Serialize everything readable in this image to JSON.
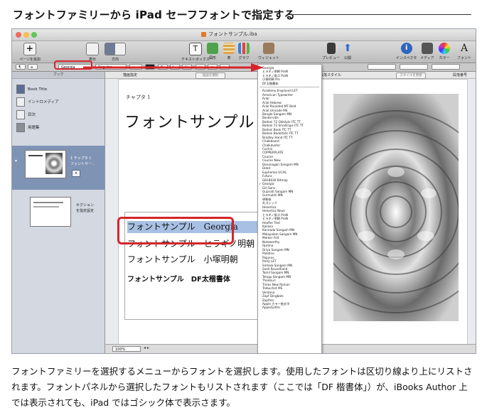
{
  "article": {
    "title": "フォントファミリーから iPad セーフフォントで指定する",
    "caption": "フォントファミリーを選択するメニューからフォントを選択します。使用したフォントは区切り線より上にリストされます。フォントパネルから選択したフォントもリストされます（ここでは「DF 楷書体」）が、iBooks Author 上では表示されても、iPad ではゴシック体で表示さます。"
  },
  "window": {
    "title": "フォントサンプル.iba"
  },
  "toolbar": {
    "buttons": [
      {
        "label": "ページを追加",
        "icon": "add-page-icon"
      },
      {
        "label": "表示",
        "icon": "view-icon"
      },
      {
        "label": "方向",
        "icon": "orientation-icon"
      },
      {
        "label": "テキストボックス",
        "icon": "textbox-icon"
      },
      {
        "label": "図形",
        "icon": "shape-icon"
      },
      {
        "label": "表",
        "icon": "table-icon"
      },
      {
        "label": "グラフ",
        "icon": "chart-icon"
      },
      {
        "label": "ウィジェット",
        "icon": "widget-icon"
      },
      {
        "label": "プレビュー",
        "icon": "preview-icon"
      },
      {
        "label": "公開",
        "icon": "publish-icon"
      },
      {
        "label": "インスペクタ",
        "icon": "inspector-icon"
      },
      {
        "label": "メディア",
        "icon": "media-icon"
      },
      {
        "label": "カラー",
        "icon": "color-icon"
      },
      {
        "label": "フォント",
        "icon": "font-icon"
      }
    ]
  },
  "formatbar": {
    "font_family": "Georgia",
    "font_style": "Regular"
  },
  "rulerbar": {
    "left_label": "描画指定",
    "left_button": "描画を選択",
    "style_label": "段落スタイル",
    "style_button": "スタイルを更新",
    "right_label": "段落番号"
  },
  "sidebar": {
    "header": "ブック",
    "items": [
      {
        "label": "Book Title",
        "icon": "book-icon"
      },
      {
        "label": "イントロメディア",
        "icon": "intro-media-icon"
      },
      {
        "label": "目次",
        "icon": "toc-icon"
      },
      {
        "label": "用語集",
        "icon": "glossary-icon"
      }
    ],
    "thumbnails": [
      {
        "label_line1": "1 チャプタ 1",
        "label_line2": "フォントサー…"
      },
      {
        "label_line1": "セクション",
        "label_line2": "を指定設定"
      }
    ]
  },
  "document": {
    "chapter_label": "チャプタ 1",
    "chapter_title": "フォントサンプル",
    "sample_lines": [
      "フォントサンプル　Georgia",
      "フォントサンプル　ヒラギノ明朝",
      "フォントサンプル　小塚明朝",
      "フォントサンプル　DF太楷書体"
    ]
  },
  "status": {
    "zoom": "100%"
  },
  "font_menu": {
    "recent": [
      "Georgia",
      "ヒラギノ明朝 ProN",
      "ヒラギノ角ゴ ProN",
      "小塚明朝 Pro",
      "DF太楷書体"
    ],
    "checked_recent": "Georgia",
    "all": [
      "Academy Engraved LET",
      "American Typewriter",
      "Arial",
      "Arial Hebrew",
      "Arial Rounded MT Bold",
      "Arial Unicode MS",
      "Bangla Sangam MN",
      "Baskerville",
      "Bodoni 72 Oldstyle ITC TT",
      "Bodoni 72 Smallcaps ITC TT",
      "Bodoni Book ITC TT",
      "Bodoni BookItalic ITC TT",
      "Bradley Hand ITC TT",
      "Chalkboard",
      "Chalkduster",
      "Cochin",
      "COPPERPLATE",
      "Courier",
      "Courier New",
      "Devanagari Sangam MN",
      "Didot",
      "Euphemia UCAS",
      "Futura",
      "GB18030 Bitmap",
      "Georgia",
      "Gill Sans",
      "Gujarati Sangam MN",
      "Gurmukhi MN",
      "明朝体",
      "丸ゴシック",
      "Helvetica",
      "Helvetica Neue",
      "ヒラギノ角ゴ ProN",
      "ヒラギノ明朝 ProN",
      "Hoefler Text",
      "Kailasa",
      "Kannada Sangam MN",
      "Malayalam Sangam MN",
      "Marker Felt",
      "Noteworthy",
      "Optima",
      "Oriya Sangam MN",
      "Palatino",
      "Papyrus",
      "Party LET",
      "Sinhala Sangam MN",
      "Snell Roundhand",
      "Tamil Sangam MN",
      "Telugu Sangam MN",
      "Thonburi",
      "Times New Roman",
      "Trebuchet MS",
      "Verdana",
      "Zapf Dingbats",
      "Zapfino",
      "Apple カラー絵文字",
      "AppleGothic"
    ],
    "checked_all": "Georgia"
  },
  "colors": {
    "annotation_red": "#d4252b",
    "selection_blue": "#a8c0e4",
    "sidebar_selected": "#7f93b5"
  }
}
